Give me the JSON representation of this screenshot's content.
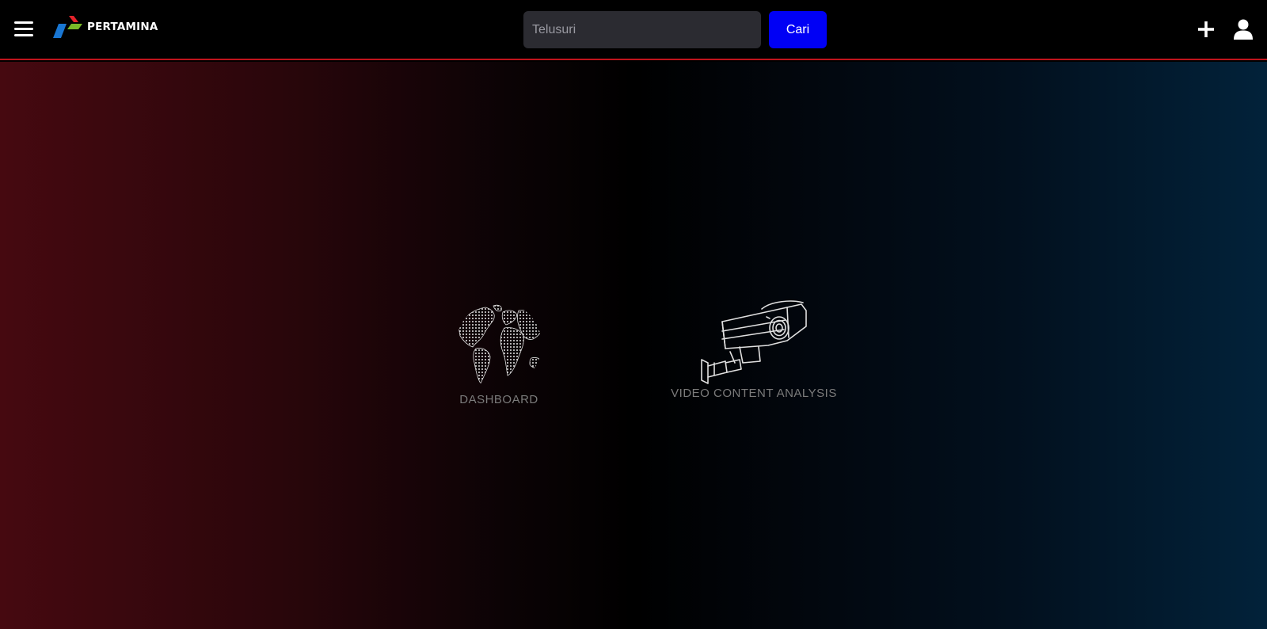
{
  "header": {
    "brand_name": "PERTAMINA",
    "search": {
      "placeholder": "Telusuri",
      "value": ""
    },
    "search_button_label": "Cari",
    "icons": [
      "menu-icon",
      "plus-icon",
      "user-icon"
    ]
  },
  "tiles": [
    {
      "label": "DASHBOARD",
      "icon": "globe-icon"
    },
    {
      "label": "VIDEO CONTENT ANALYSIS",
      "icon": "cctv-camera-icon"
    }
  ],
  "colors": {
    "accent_line": "#c0141c",
    "search_button": "#0000f5",
    "gradient_left": "#460910",
    "gradient_right": "#02223a"
  }
}
